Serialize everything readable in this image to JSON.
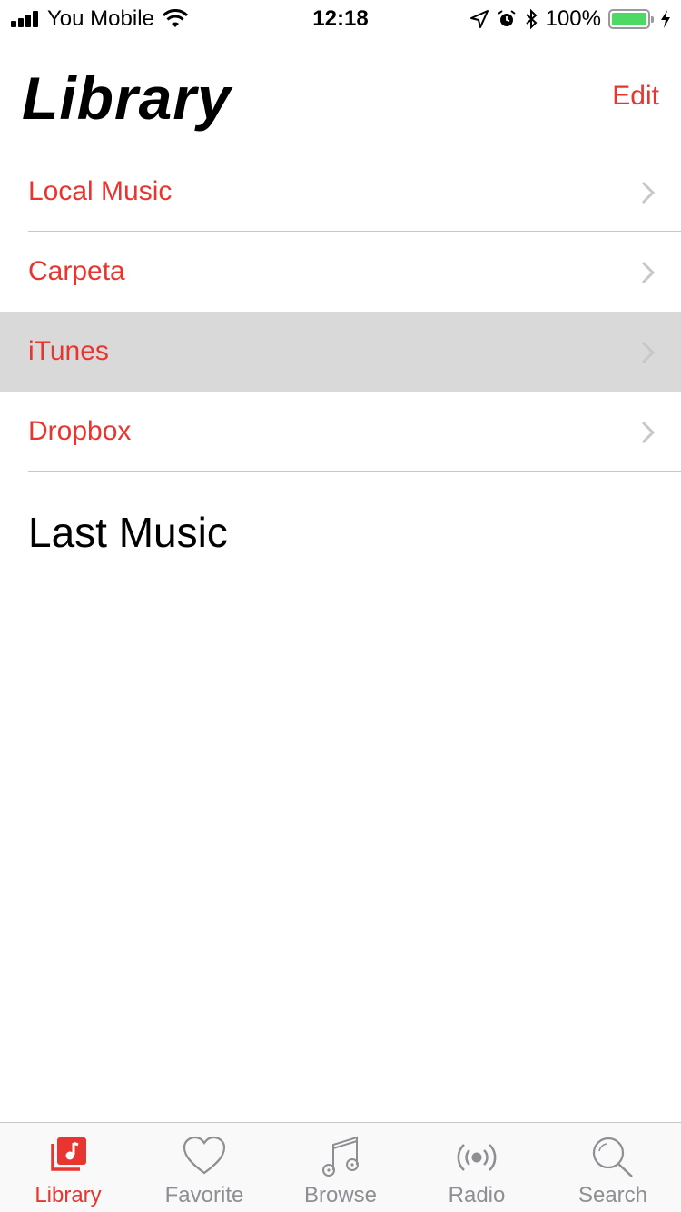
{
  "status_bar": {
    "carrier": "You Mobile",
    "time": "12:18",
    "battery_percent": "100%",
    "battery_level": 1.0,
    "icons": [
      "signal-icon",
      "wifi-icon",
      "location-icon",
      "alarm-icon",
      "bluetooth-icon",
      "battery-icon",
      "charging-icon"
    ]
  },
  "header": {
    "title": "Library",
    "edit_label": "Edit"
  },
  "library_items": [
    {
      "label": "Local Music",
      "highlighted": false
    },
    {
      "label": "Carpeta",
      "highlighted": false
    },
    {
      "label": "iTunes",
      "highlighted": true
    },
    {
      "label": "Dropbox",
      "highlighted": false
    }
  ],
  "section": {
    "title": "Last Music"
  },
  "tabs": [
    {
      "label": "Library",
      "icon": "music-library-icon",
      "active": true
    },
    {
      "label": "Favorite",
      "icon": "heart-icon",
      "active": false
    },
    {
      "label": "Browse",
      "icon": "music-note-icon",
      "active": false
    },
    {
      "label": "Radio",
      "icon": "radio-broadcast-icon",
      "active": false
    },
    {
      "label": "Search",
      "icon": "search-icon",
      "active": false
    }
  ],
  "colors": {
    "accent": "#e8352f",
    "inactive": "#8e8e93",
    "highlight_row": "#d9d9d9",
    "battery": "#4cd964"
  }
}
